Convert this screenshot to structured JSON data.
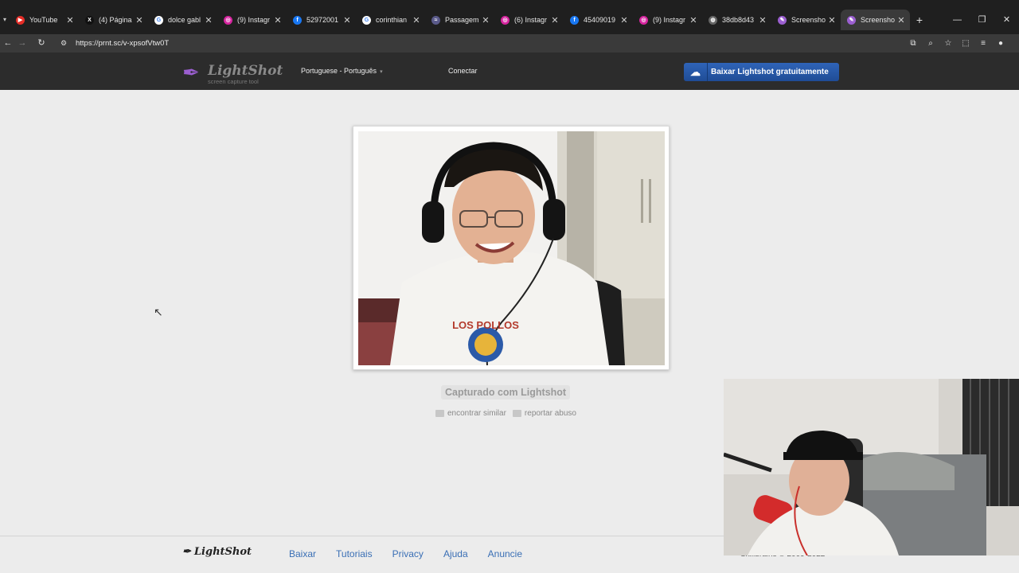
{
  "browser": {
    "tabs": [
      {
        "title": "YouTube",
        "favicon": "youtube-icon",
        "color": "#e52d27",
        "glyph": "▶"
      },
      {
        "title": "(4) Página",
        "favicon": "x-icon",
        "color": "#111111",
        "glyph": "X"
      },
      {
        "title": "dolce gabl",
        "favicon": "google-icon",
        "color": "#ffffff",
        "glyph": "G"
      },
      {
        "title": "(9) Instagr",
        "favicon": "instagram-icon",
        "color": "#d6249f",
        "glyph": "◎"
      },
      {
        "title": "52972001",
        "favicon": "facebook-icon",
        "color": "#1877f2",
        "glyph": "f"
      },
      {
        "title": "corinthian",
        "favicon": "google-icon",
        "color": "#ffffff",
        "glyph": "G"
      },
      {
        "title": "Passagem",
        "favicon": "page-icon",
        "color": "#5a5a8a",
        "glyph": "≈"
      },
      {
        "title": "(6) Instagr",
        "favicon": "instagram-icon",
        "color": "#d6249f",
        "glyph": "◎"
      },
      {
        "title": "45409019",
        "favicon": "facebook-icon",
        "color": "#1877f2",
        "glyph": "f"
      },
      {
        "title": "(9) Instagr",
        "favicon": "instagram-icon",
        "color": "#d6249f",
        "glyph": "◎"
      },
      {
        "title": "38db8d43",
        "favicon": "globe-icon",
        "color": "#666666",
        "glyph": "◍"
      },
      {
        "title": "Screensho",
        "favicon": "lightshot-icon",
        "color": "#9b5fd0",
        "glyph": "✎"
      },
      {
        "title": "Screensho",
        "favicon": "lightshot-icon",
        "color": "#9b5fd0",
        "glyph": "✎",
        "active": true
      }
    ],
    "url": "https://prnt.sc/v-xpsofVtw0T"
  },
  "header": {
    "logo_name": "LightShot",
    "logo_tagline": "screen capture tool",
    "language": "Portuguese - Português",
    "connect": "Conectar",
    "download_button": "Baixar Lightshot gratuitamente"
  },
  "main": {
    "caption": "Capturado com Lightshot",
    "find_similar": "encontrar similar",
    "report_abuse": "reportar abuso",
    "shirt_text": "LOS POLLOS"
  },
  "footer": {
    "logo": "LightShot",
    "links": [
      "Baixar",
      "Tutoriais",
      "Privacy",
      "Ajuda",
      "Anuncie"
    ],
    "copyright": "Skillbrains © 2009-2022"
  }
}
